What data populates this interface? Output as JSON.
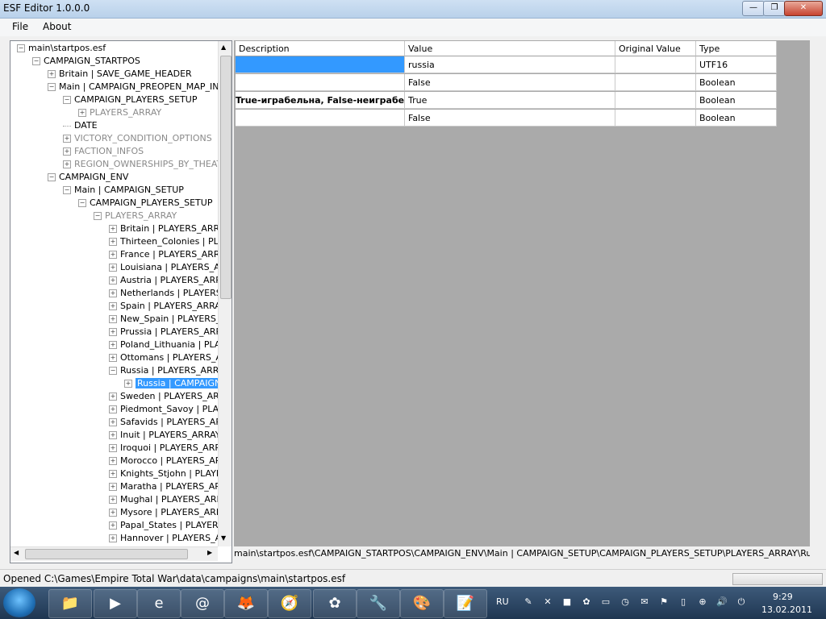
{
  "window": {
    "title": "ESF Editor 1.0.0.0",
    "min": "—",
    "max": "❐",
    "close": "✕"
  },
  "menu": [
    {
      "label": "File"
    },
    {
      "label": "About"
    }
  ],
  "tree": [
    {
      "label": "main\\startpos.esf",
      "level": 0,
      "exp": "-",
      "gray": false
    },
    {
      "label": "CAMPAIGN_STARTPOS",
      "level": 1,
      "exp": "-",
      "gray": false
    },
    {
      "label": "Britain | SAVE_GAME_HEADER",
      "level": 2,
      "exp": "+",
      "gray": false
    },
    {
      "label": "Main | CAMPAIGN_PREOPEN_MAP_INFO",
      "level": 2,
      "exp": "-",
      "gray": false
    },
    {
      "label": "CAMPAIGN_PLAYERS_SETUP",
      "level": 3,
      "exp": "-",
      "gray": false
    },
    {
      "label": "PLAYERS_ARRAY",
      "level": 4,
      "exp": "+",
      "gray": true
    },
    {
      "label": "DATE",
      "level": 3,
      "exp": "",
      "gray": false
    },
    {
      "label": "VICTORY_CONDITION_OPTIONS",
      "level": 3,
      "exp": "+",
      "gray": true
    },
    {
      "label": "FACTION_INFOS",
      "level": 3,
      "exp": "+",
      "gray": true
    },
    {
      "label": "REGION_OWNERSHIPS_BY_THEATRE",
      "level": 3,
      "exp": "+",
      "gray": true
    },
    {
      "label": "CAMPAIGN_ENV",
      "level": 2,
      "exp": "-",
      "gray": false
    },
    {
      "label": "Main | CAMPAIGN_SETUP",
      "level": 3,
      "exp": "-",
      "gray": false
    },
    {
      "label": "CAMPAIGN_PLAYERS_SETUP",
      "level": 4,
      "exp": "-",
      "gray": false
    },
    {
      "label": "PLAYERS_ARRAY",
      "level": 5,
      "exp": "-",
      "gray": true
    },
    {
      "label": "Britain | PLAYERS_ARRAY",
      "level": 6,
      "exp": "+",
      "gray": false
    },
    {
      "label": "Thirteen_Colonies | PLAYERS_ARRAY",
      "level": 6,
      "exp": "+",
      "gray": false
    },
    {
      "label": "France | PLAYERS_ARRAY",
      "level": 6,
      "exp": "+",
      "gray": false
    },
    {
      "label": "Louisiana | PLAYERS_ARRAY",
      "level": 6,
      "exp": "+",
      "gray": false
    },
    {
      "label": "Austria | PLAYERS_ARRAY",
      "level": 6,
      "exp": "+",
      "gray": false
    },
    {
      "label": "Netherlands | PLAYERS_ARRAY",
      "level": 6,
      "exp": "+",
      "gray": false
    },
    {
      "label": "Spain | PLAYERS_ARRAY",
      "level": 6,
      "exp": "+",
      "gray": false
    },
    {
      "label": "New_Spain | PLAYERS_ARRAY",
      "level": 6,
      "exp": "+",
      "gray": false
    },
    {
      "label": "Prussia | PLAYERS_ARRAY",
      "level": 6,
      "exp": "+",
      "gray": false
    },
    {
      "label": "Poland_Lithuania | PLAYERS_ARRAY",
      "level": 6,
      "exp": "+",
      "gray": false
    },
    {
      "label": "Ottomans | PLAYERS_ARRAY",
      "level": 6,
      "exp": "+",
      "gray": false
    },
    {
      "label": "Russia | PLAYERS_ARRAY",
      "level": 6,
      "exp": "-",
      "gray": false
    },
    {
      "label": "Russia | CAMPAIGN_PLAYER_SETUP",
      "level": 7,
      "exp": "+",
      "gray": false,
      "selected": true
    },
    {
      "label": "Sweden | PLAYERS_ARRAY",
      "level": 6,
      "exp": "+",
      "gray": false
    },
    {
      "label": "Piedmont_Savoy | PLAYERS_ARRAY",
      "level": 6,
      "exp": "+",
      "gray": false
    },
    {
      "label": "Safavids | PLAYERS_ARRAY",
      "level": 6,
      "exp": "+",
      "gray": false
    },
    {
      "label": "Inuit | PLAYERS_ARRAY",
      "level": 6,
      "exp": "+",
      "gray": false
    },
    {
      "label": "Iroquoi | PLAYERS_ARRAY",
      "level": 6,
      "exp": "+",
      "gray": false
    },
    {
      "label": "Morocco | PLAYERS_ARRAY",
      "level": 6,
      "exp": "+",
      "gray": false
    },
    {
      "label": "Knights_Stjohn | PLAYERS_ARRAY",
      "level": 6,
      "exp": "+",
      "gray": false
    },
    {
      "label": "Maratha | PLAYERS_ARRAY",
      "level": 6,
      "exp": "+",
      "gray": false
    },
    {
      "label": "Mughal | PLAYERS_ARRAY",
      "level": 6,
      "exp": "+",
      "gray": false
    },
    {
      "label": "Mysore | PLAYERS_ARRAY",
      "level": 6,
      "exp": "+",
      "gray": false
    },
    {
      "label": "Papal_States | PLAYERS_ARRAY",
      "level": 6,
      "exp": "+",
      "gray": false
    },
    {
      "label": "Hannover | PLAYERS_ARRAY",
      "level": 6,
      "exp": "+",
      "gray": false
    }
  ],
  "grid": {
    "columns": [
      "Description",
      "Value",
      "Original Value",
      "Type"
    ],
    "rows": [
      {
        "description": "",
        "value": "russia",
        "original": "",
        "type": "UTF16",
        "desc_selected": true
      },
      {
        "description": "",
        "value": "False",
        "original": "",
        "type": "Boolean"
      },
      {
        "description": "True-играбельна, False-неиграбельна",
        "value": "True",
        "original": "",
        "type": "Boolean",
        "desc_bold": true
      },
      {
        "description": "",
        "value": "False",
        "original": "",
        "type": "Boolean"
      }
    ]
  },
  "path": "main\\startpos.esf\\CAMPAIGN_STARTPOS\\CAMPAIGN_ENV\\Main | CAMPAIGN_SETUP\\CAMPAIGN_PLAYERS_SETUP\\PLAYERS_ARRAY\\Russia | PLAYERS_ARRAY\\Russia | CAMPAIGN_PLAYER_SETUP",
  "status": "Opened C:\\Games\\Empire Total War\\data\\campaigns\\main\\startpos.esf",
  "taskbar": {
    "lang": "RU",
    "time": "9:29",
    "date": "13.02.2011",
    "apps": [
      "📁",
      "▶",
      "e",
      "@",
      "🦊",
      "🧭",
      "✿",
      "🔧",
      "🎨",
      "📝"
    ],
    "tray": [
      "✎",
      "✕",
      "■",
      "✿",
      "▭",
      "◷",
      "✉",
      "⚑",
      "▯",
      "⊕",
      "🔊",
      "⏻"
    ]
  }
}
